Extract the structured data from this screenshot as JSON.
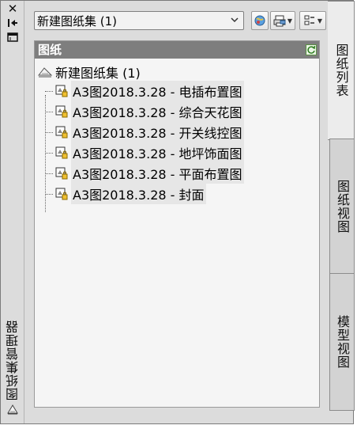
{
  "window": {
    "title": "图纸集管理器"
  },
  "toolbar": {
    "sheet_set_select": "新建图纸集 (1)"
  },
  "tabs": [
    {
      "label": "图纸列表",
      "active": true
    },
    {
      "label": "图纸视图",
      "active": false
    },
    {
      "label": "模型视图",
      "active": false
    }
  ],
  "panel": {
    "header": "图纸",
    "root_label": "新建图纸集 (1)",
    "sheets": [
      {
        "label": "A3图2018.3.28 - 电插布置图"
      },
      {
        "label": "A3图2018.3.28 - 综合天花图"
      },
      {
        "label": "A3图2018.3.28 - 开关线控图"
      },
      {
        "label": "A3图2018.3.28 - 地坪饰面图"
      },
      {
        "label": "A3图2018.3.28 - 平面布置图"
      },
      {
        "label": "A3图2018.3.28 - 封面"
      }
    ]
  },
  "colors": {
    "panel_header_bg": "#7e7e7e",
    "window_bg": "#dcdcdc",
    "list_bg": "#f5f5f5"
  }
}
